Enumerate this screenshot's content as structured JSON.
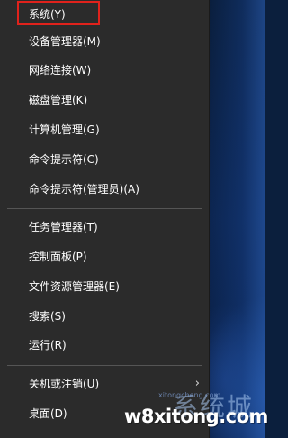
{
  "menu": {
    "items": [
      {
        "label": "系统(Y)"
      },
      {
        "label": "设备管理器(M)"
      },
      {
        "label": "网络连接(W)"
      },
      {
        "label": "磁盘管理(K)"
      },
      {
        "label": "计算机管理(G)"
      },
      {
        "label": "命令提示符(C)"
      },
      {
        "label": "命令提示符(管理员)(A)"
      },
      {
        "label": "任务管理器(T)"
      },
      {
        "label": "控制面板(P)"
      },
      {
        "label": "文件资源管理器(E)"
      },
      {
        "label": "搜索(S)"
      },
      {
        "label": "运行(R)"
      },
      {
        "label": "关机或注销(U)",
        "chevron": "›"
      },
      {
        "label": "桌面(D)"
      }
    ],
    "highlight_color": "#e0221c"
  },
  "watermark": {
    "text": "w8xitong.com",
    "cn_text": "系统城",
    "small_text": "xitongcheng.com"
  }
}
